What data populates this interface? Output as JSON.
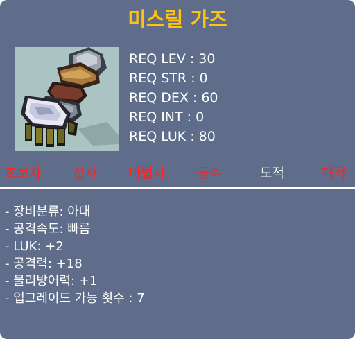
{
  "item": {
    "name": "미스릴 가즈",
    "name_color": "#ffc20e",
    "icon": "mithril-garnet-glove-icon"
  },
  "requirements": [
    {
      "label": "REQ LEV : 30"
    },
    {
      "label": "REQ STR : 0"
    },
    {
      "label": "REQ DEX : 60"
    },
    {
      "label": "REQ INT : 0"
    },
    {
      "label": "REQ LUK : 80"
    }
  ],
  "jobs": [
    {
      "label": "초보자",
      "color": "#ff2020",
      "available": false
    },
    {
      "label": "전사",
      "color": "#ff2020",
      "available": false
    },
    {
      "label": "마법사",
      "color": "#ff2020",
      "available": false
    },
    {
      "label": "궁수",
      "color": "#ff2020",
      "available": false
    },
    {
      "label": "도적",
      "color": "#ffffff",
      "available": true
    },
    {
      "label": "해적",
      "color": "#ff2020",
      "available": false
    }
  ],
  "stats": [
    {
      "label": "- 장비분류: 아대"
    },
    {
      "label": "- 공격속도: 빠름"
    },
    {
      "label": "- LUK: +2"
    },
    {
      "label": "- 공격력: +18"
    },
    {
      "label": "- 물리방어력: +1"
    },
    {
      "label": "- 업그레이드 가능 횟수 : 7"
    }
  ],
  "colors": {
    "background": "#5f6d8a",
    "title": "#ffc20e",
    "text": "#ffffff",
    "unavailable_job": "#ff2020",
    "icon_frame": "#a9c4c2"
  }
}
